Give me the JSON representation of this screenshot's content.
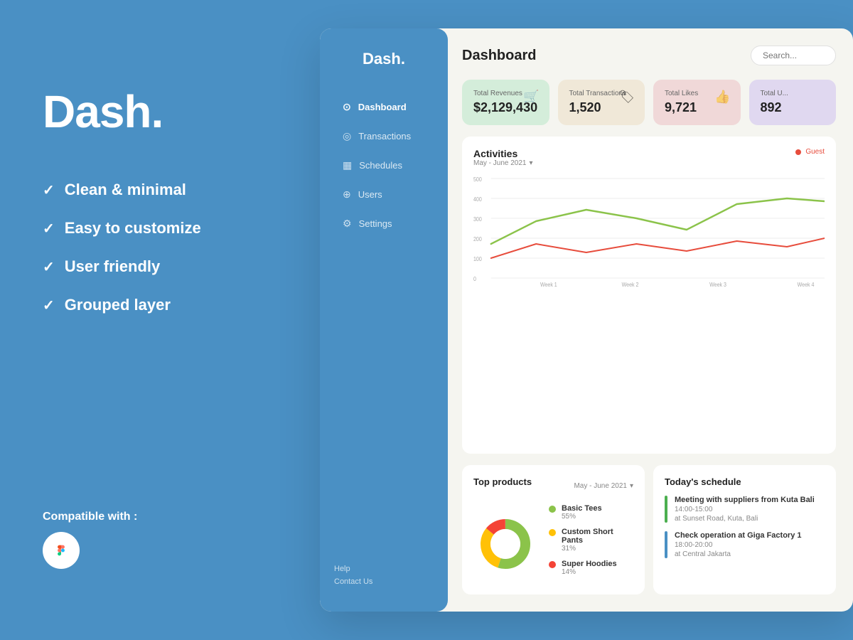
{
  "left": {
    "brand": "Dash.",
    "features": [
      "Clean & minimal",
      "Easy to customize",
      "User friendly",
      "Grouped layer"
    ],
    "compatible_label": "Compatible with :"
  },
  "dashboard": {
    "sidebar": {
      "logo": "Dash.",
      "nav_items": [
        {
          "label": "Dashboard",
          "icon": "⊙",
          "active": true
        },
        {
          "label": "Transactions",
          "icon": "◎",
          "active": false
        },
        {
          "label": "Schedules",
          "icon": "▦",
          "active": false
        },
        {
          "label": "Users",
          "icon": "⊕",
          "active": false
        },
        {
          "label": "Settings",
          "icon": "⚙",
          "active": false
        }
      ],
      "footer_links": [
        "Help",
        "Contact Us"
      ]
    },
    "header": {
      "title": "Dashboard",
      "search_placeholder": "Search..."
    },
    "stats": [
      {
        "label": "Total Revenues",
        "value": "$2,129,430",
        "icon": "🛒",
        "color": "green"
      },
      {
        "label": "Total Transactions",
        "value": "1,520",
        "icon": "🏷",
        "color": "beige"
      },
      {
        "label": "Total Likes",
        "value": "9,721",
        "icon": "👍",
        "color": "pink"
      },
      {
        "label": "Total U...",
        "value": "892",
        "icon": "",
        "color": "purple"
      }
    ],
    "chart": {
      "title": "Activities",
      "subtitle": "May - June 2021",
      "legend_label": "Guest",
      "y_labels": [
        "500",
        "400",
        "300",
        "200",
        "100",
        "0"
      ],
      "x_labels": [
        "Week 1",
        "Week 2",
        "Week 3",
        "Week 4"
      ]
    },
    "top_products": {
      "title": "Top products",
      "date_filter": "May - June 2021",
      "items": [
        {
          "label": "Basic Tees",
          "pct": "55%",
          "color": "#8bc34a"
        },
        {
          "label": "Custom Short Pants",
          "pct": "31%",
          "color": "#ffc107"
        },
        {
          "label": "Super Hoodies",
          "pct": "14%",
          "color": "#f44336"
        }
      ]
    },
    "schedule": {
      "title": "Today's schedule",
      "items": [
        {
          "title": "Meeting with suppliers from Kuta Bali",
          "time": "14:00-15:00",
          "location": "at Sunset Road, Kuta, Bali",
          "color": "green"
        },
        {
          "title": "Check operation at Giga Factory 1",
          "time": "18:00-20:00",
          "location": "at Central Jakarta",
          "color": "blue"
        }
      ]
    }
  }
}
